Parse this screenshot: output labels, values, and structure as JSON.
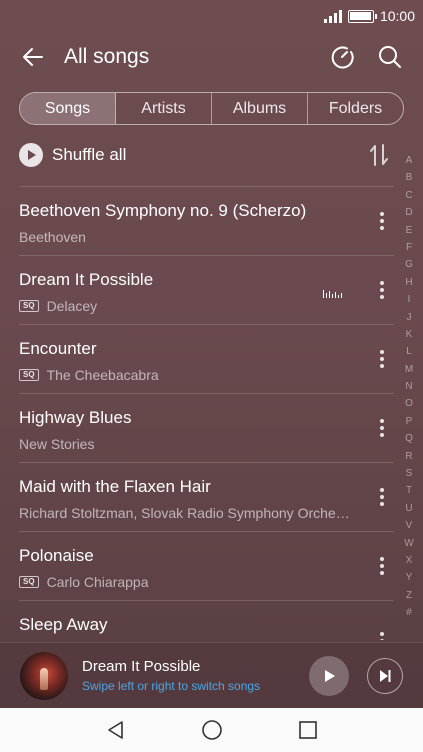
{
  "status_bar": {
    "time": "10:00"
  },
  "header": {
    "title": "All songs",
    "back_icon": "back-arrow-icon",
    "actions": [
      "timer-icon",
      "search-icon"
    ]
  },
  "tabs": [
    {
      "label": "Songs",
      "active": true
    },
    {
      "label": "Artists",
      "active": false
    },
    {
      "label": "Albums",
      "active": false
    },
    {
      "label": "Folders",
      "active": false
    }
  ],
  "shuffle": {
    "label": "Shuffle all"
  },
  "songs": [
    {
      "title": "Beethoven Symphony no. 9 (Scherzo)",
      "artist": "Beethoven",
      "sq": false,
      "playing": false
    },
    {
      "title": "Dream It Possible",
      "artist": "Delacey",
      "sq": true,
      "playing": true
    },
    {
      "title": "Encounter",
      "artist": "The Cheebacabra",
      "sq": true,
      "playing": false
    },
    {
      "title": "Highway Blues",
      "artist": "New Stories",
      "sq": false,
      "playing": false
    },
    {
      "title": "Maid with the Flaxen Hair",
      "artist": "Richard Stoltzman, Slovak Radio Symphony Orche…",
      "sq": false,
      "playing": false
    },
    {
      "title": "Polonaise",
      "artist": "Carlo Chiarappa",
      "sq": true,
      "playing": false
    },
    {
      "title": "Sleep Away",
      "artist": "",
      "sq": false,
      "playing": false
    }
  ],
  "sq_badge": "SQ",
  "alphabet": [
    "A",
    "B",
    "C",
    "D",
    "E",
    "F",
    "G",
    "H",
    "I",
    "J",
    "K",
    "L",
    "M",
    "N",
    "O",
    "P",
    "Q",
    "R",
    "S",
    "T",
    "U",
    "V",
    "W",
    "X",
    "Y",
    "Z",
    "#"
  ],
  "mini_player": {
    "title": "Dream It Possible",
    "hint": "Swipe left or right to switch songs"
  },
  "colors": {
    "hint": "#4aa6e8",
    "background": "#6a4a4e"
  }
}
